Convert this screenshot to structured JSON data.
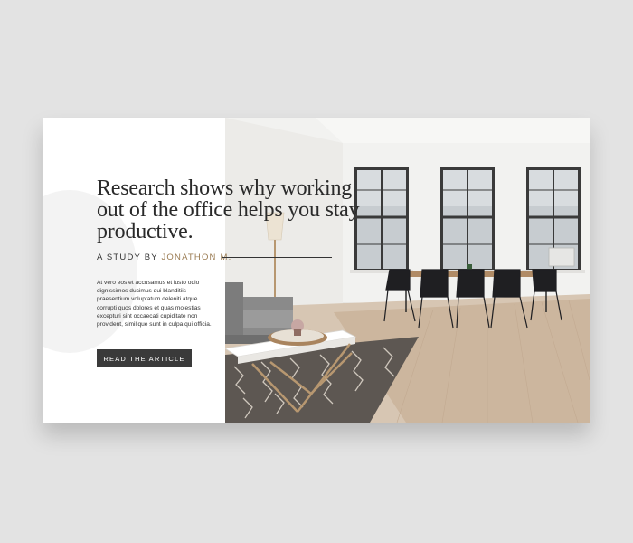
{
  "hero": {
    "headline": "Research shows why working out of the office helps you stay productive.",
    "byline_prefix": "A STUDY BY",
    "byline_author": "JONATHON M.",
    "body": "At vero eos et accusamus et iusto odio dignissimos ducimus qui blanditiis praesentium voluptatum deleniti atque corrupti quos dolores et quas molestias excepturi sint occaecati cupiditate non provident, similique sunt in culpa qui officia.",
    "cta_label": "READ THE ARTICLE"
  },
  "colors": {
    "page_bg": "#e3e3e3",
    "card_bg": "#ffffff",
    "headline": "#2a2a2a",
    "author_accent": "#9a7b52",
    "button_bg": "#3a3a3a",
    "button_text": "#ffffff"
  },
  "image": {
    "subject": "bright loft interior with tall windows, grey sofa, coffee table, patterned rug and dining table with black chairs"
  }
}
